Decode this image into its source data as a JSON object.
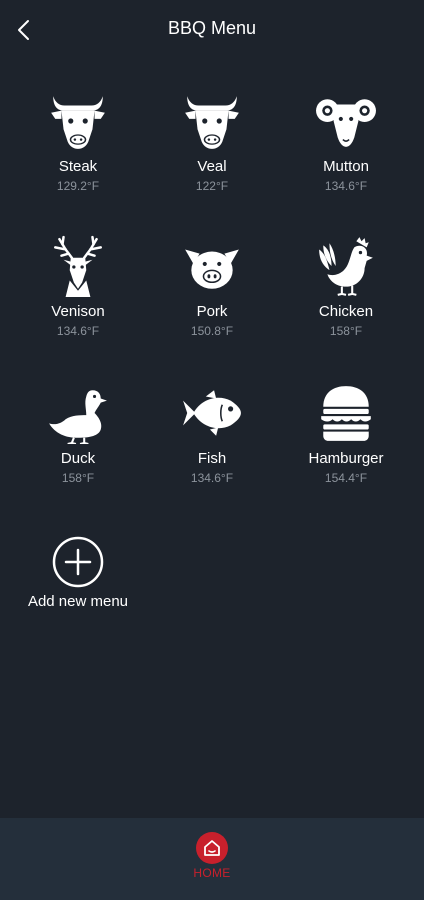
{
  "header": {
    "title": "BBQ Menu",
    "back_icon": "chevron-left-icon"
  },
  "menu": {
    "items": [
      {
        "name": "Steak",
        "temp": "129.2°F",
        "icon": "cow-icon"
      },
      {
        "name": "Veal",
        "temp": "122°F",
        "icon": "cow-icon"
      },
      {
        "name": "Mutton",
        "temp": "134.6°F",
        "icon": "ram-icon"
      },
      {
        "name": "Venison",
        "temp": "134.6°F",
        "icon": "deer-icon"
      },
      {
        "name": "Pork",
        "temp": "150.8°F",
        "icon": "pig-icon"
      },
      {
        "name": "Chicken",
        "temp": "158°F",
        "icon": "rooster-icon"
      },
      {
        "name": "Duck",
        "temp": "158°F",
        "icon": "duck-icon"
      },
      {
        "name": "Fish",
        "temp": "134.6°F",
        "icon": "fish-icon"
      },
      {
        "name": "Hamburger",
        "temp": "154.4°F",
        "icon": "hamburger-icon"
      }
    ],
    "add_label": "Add new menu",
    "add_icon": "plus-circle-icon"
  },
  "tabbar": {
    "home_label": "HOME",
    "home_icon": "home-icon"
  },
  "colors": {
    "background": "#1d232c",
    "tabbar": "#242f3b",
    "accent": "#c8202c",
    "secondary_text": "#8c939c"
  }
}
